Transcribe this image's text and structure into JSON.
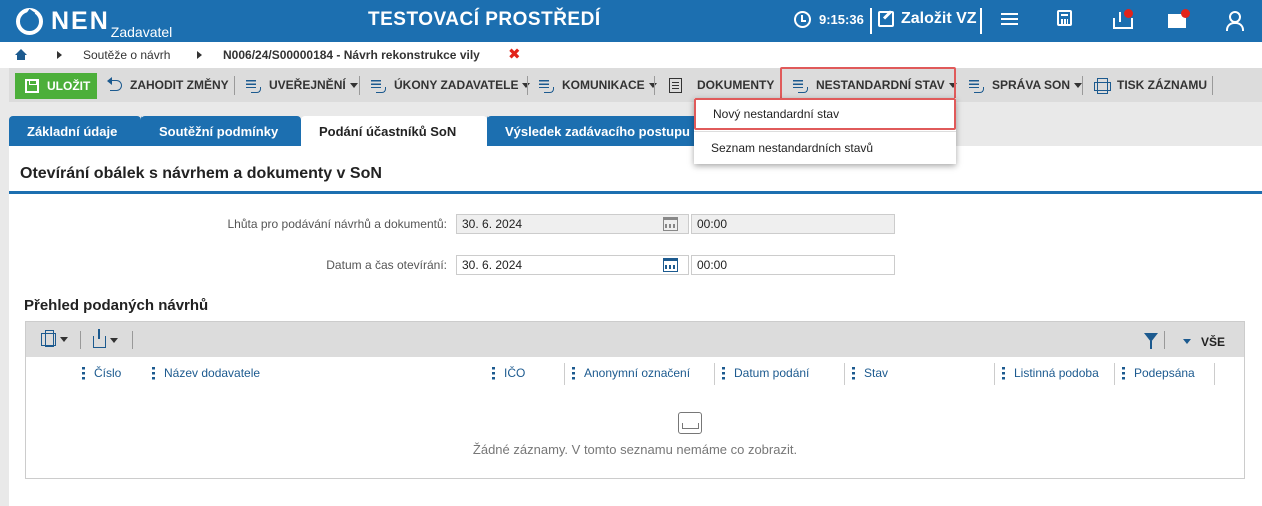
{
  "header": {
    "logo": "NEN",
    "logo_sub": "Zadavatel",
    "env_title": "TESTOVACÍ PROSTŘEDÍ",
    "time": "9:15:36",
    "create_vz": "Založit VZ",
    "icons": [
      "clock-icon",
      "pencil-icon",
      "menu-icon",
      "calculator-icon",
      "inbox-icon",
      "mail-icon",
      "user-icon"
    ],
    "accent": "#1c6fb0",
    "notification_color": "#e2231a"
  },
  "breadcrumb": {
    "items": [
      "Soutěže o návrh",
      "N006/24/S00000184 - Návrh rekonstrukce vily"
    ],
    "close": "✖"
  },
  "toolbar": {
    "save": "ULOŽIT",
    "discard": "ZAHODIT ZMĚNY",
    "publish": "UVEŘEJNĚNÍ",
    "actions": "ÚKONY ZADAVATELE",
    "communication": "KOMUNIKACE",
    "documents": "DOKUMENTY",
    "nonstandard": "NESTANDARDNÍ STAV",
    "son_admin": "SPRÁVA SON",
    "print": "TISK ZÁZNAMU",
    "save_color": "#4caf3a"
  },
  "dropdown": {
    "items": [
      "Nový nestandardní stav",
      "Seznam nestandardních stavů"
    ]
  },
  "tabs": [
    "Základní údaje",
    "Soutěžní podmínky",
    "Podání účastníků SoN",
    "Výsledek zadávacího postupu"
  ],
  "main": {
    "section_title": "Otevírání obálek s návrhem a dokumenty v SoN",
    "deadline_label": "Lhůta pro podávání návrhů a dokumentů:",
    "deadline_date": "30. 6. 2024",
    "deadline_time": "00:00",
    "opening_label": "Datum a čas otevírání:",
    "opening_date": "30. 6. 2024",
    "opening_time": "00:00",
    "subtitle": "Přehled podaných návrhů"
  },
  "grid": {
    "columns": [
      "Číslo",
      "Název dodavatele",
      "IČO",
      "Anonymní označení",
      "Datum podání",
      "Stav",
      "Listinná podoba",
      "Podepsána"
    ],
    "view_all": "VŠE",
    "empty_text": "Žádné záznamy. V tomto seznamu nemáme co zobrazit."
  }
}
